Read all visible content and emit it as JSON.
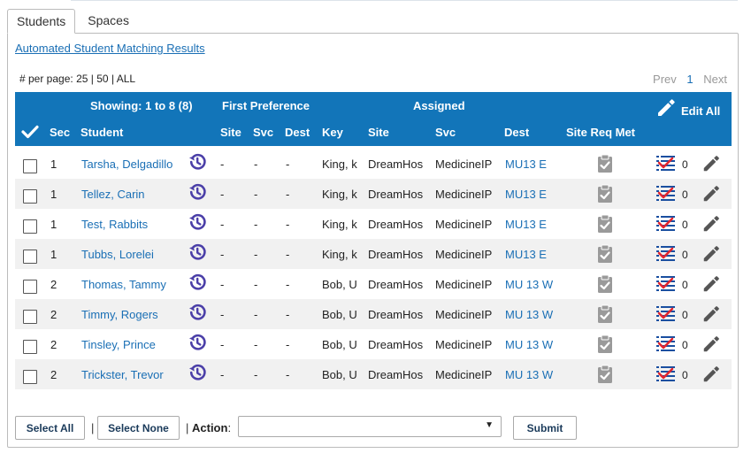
{
  "tabs": [
    {
      "label": "Students",
      "active": true
    },
    {
      "label": "Spaces",
      "active": false
    }
  ],
  "matching_link": "Automated Student Matching Results",
  "per_page": {
    "label": "# per page:",
    "options": [
      "25",
      "50",
      "ALL"
    ],
    "sep": "|"
  },
  "pager": {
    "prev": "Prev",
    "current": "1",
    "next": "Next"
  },
  "grid": {
    "showing": "Showing: 1 to 8 (8)",
    "first_preference": "First Preference",
    "assigned": "Assigned",
    "edit_all": "Edit All",
    "columns": {
      "sec": "Sec",
      "student": "Student",
      "pref_site": "Site",
      "pref_svc": "Svc",
      "pref_dest": "Dest",
      "key": "Key",
      "site": "Site",
      "svc": "Svc",
      "dest": "Dest",
      "site_req_met": "Site Req Met"
    },
    "accent_color": "#1275b9",
    "link_color": "#1a6fb5",
    "history_icon_color": "#4b3fa8"
  },
  "rows": [
    {
      "sec": "1",
      "student": "Tarsha, Delgadillo",
      "pref_site": "-",
      "pref_svc": "-",
      "pref_dest": "-",
      "key": "King, k",
      "site": "DreamHos",
      "svc": "MedicineIP",
      "dest": "MU13 E",
      "count": "0"
    },
    {
      "sec": "1",
      "student": "Tellez, Carin",
      "pref_site": "-",
      "pref_svc": "-",
      "pref_dest": "-",
      "key": "King, k",
      "site": "DreamHos",
      "svc": "MedicineIP",
      "dest": "MU13 E",
      "count": "0"
    },
    {
      "sec": "1",
      "student": "Test, Rabbits",
      "pref_site": "-",
      "pref_svc": "-",
      "pref_dest": "-",
      "key": "King, k",
      "site": "DreamHos",
      "svc": "MedicineIP",
      "dest": "MU13 E",
      "count": "0"
    },
    {
      "sec": "1",
      "student": "Tubbs, Lorelei",
      "pref_site": "-",
      "pref_svc": "-",
      "pref_dest": "-",
      "key": "King, k",
      "site": "DreamHos",
      "svc": "MedicineIP",
      "dest": "MU13 E",
      "count": "0"
    },
    {
      "sec": "2",
      "student": "Thomas, Tammy",
      "pref_site": "-",
      "pref_svc": "-",
      "pref_dest": "-",
      "key": "Bob, U",
      "site": "DreamHos",
      "svc": "MedicineIP",
      "dest": "MU 13 W",
      "count": "0"
    },
    {
      "sec": "2",
      "student": "Timmy, Rogers",
      "pref_site": "-",
      "pref_svc": "-",
      "pref_dest": "-",
      "key": "Bob, U",
      "site": "DreamHos",
      "svc": "MedicineIP",
      "dest": "MU 13 W",
      "count": "0"
    },
    {
      "sec": "2",
      "student": "Tinsley, Prince",
      "pref_site": "-",
      "pref_svc": "-",
      "pref_dest": "-",
      "key": "Bob, U",
      "site": "DreamHos",
      "svc": "MedicineIP",
      "dest": "MU 13 W",
      "count": "0"
    },
    {
      "sec": "2",
      "student": "Trickster, Trevor",
      "pref_site": "-",
      "pref_svc": "-",
      "pref_dest": "-",
      "key": "Bob, U",
      "site": "DreamHos",
      "svc": "MedicineIP",
      "dest": "MU 13 W",
      "count": "0"
    }
  ],
  "bottom": {
    "select_all": "Select All",
    "select_none": "Select None",
    "sep": "|",
    "action_label": "Action",
    "action_colon": ":",
    "action_value": "",
    "submit": "Submit"
  }
}
